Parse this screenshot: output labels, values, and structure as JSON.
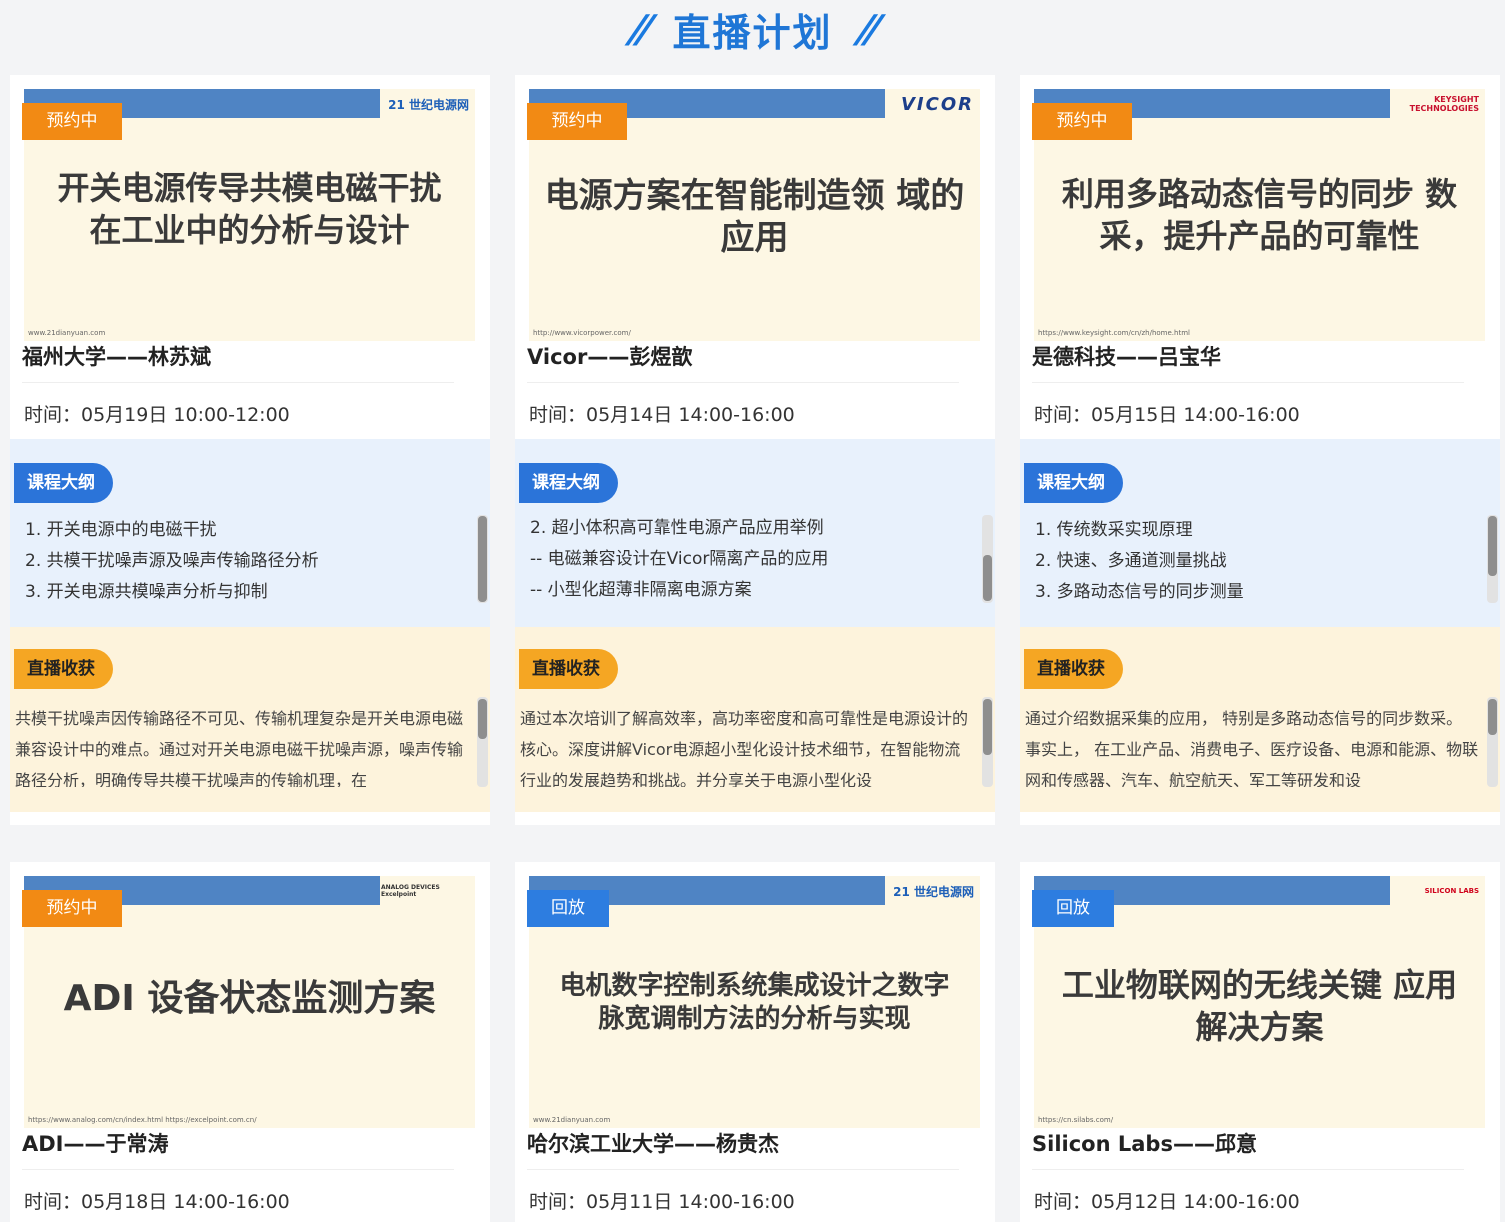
{
  "page": {
    "title": "直播计划"
  },
  "cards": [
    {
      "status": "预约中",
      "headline": "开关电源传导共模电磁干扰 在工业中的分析与设计",
      "logo": "21 世纪电源网",
      "url": "www.21dianyuan.com",
      "speaker": "福州大学——林苏斌",
      "time": "时间：05月19日 10:00-12:00",
      "outline_label": "课程大纲",
      "outline": [
        "1. 开关电源中的电磁干扰",
        "2. 共模干扰噪声源及噪声传输路径分析",
        "3. 开关电源共模噪声分析与抑制"
      ],
      "harvest_label": "直播收获",
      "harvest": "共模干扰噪声因传输路径不可见、传输机理复杂是开关电源电磁兼容设计中的难点。通过对开关电源电磁干扰噪声源，噪声传输路径分析，明确传导共模干扰噪声的传输机理，在"
    },
    {
      "status": "预约中",
      "headline": "电源方案在智能制造领 域的应用",
      "logo": "VICOR",
      "url": "http://www.vicorpower.com/",
      "speaker": "Vicor——彭煜歆",
      "time": "时间：05月14日 14:00-16:00",
      "outline_label": "课程大纲",
      "outline": [
        "2.  超小体积高可靠性电源产品应用举例",
        "-- 电磁兼容设计在Vicor隔离产品的应用",
        "-- 小型化超薄非隔离电源方案"
      ],
      "harvest_label": "直播收获",
      "harvest": "通过本次培训了解高效率，高功率密度和高可靠性是电源设计的核心。深度讲解Vicor电源超小型化设计技术细节，在智能物流行业的发展趋势和挑战。并分享关于电源小型化设"
    },
    {
      "status": "预约中",
      "headline": "利用多路动态信号的同步 数采，提升产品的可靠性",
      "logo": "KEYSIGHT TECHNOLOGIES",
      "url": "https://www.keysight.com/cn/zh/home.html",
      "speaker": "是德科技——吕宝华",
      "time": "时间：05月15日 14:00-16:00",
      "outline_label": "课程大纲",
      "outline": [
        "1. 传统数采实现原理",
        "2. 快速、多通道测量挑战",
        "3. 多路动态信号的同步测量"
      ],
      "harvest_label": "直播收获",
      "harvest": "通过介绍数据采集的应用， 特别是多路动态信号的同步数采。 事实上， 在工业产品、消费电子、医疗设备、电源和能源、物联网和传感器、汽车、航空航天、军工等研发和设"
    },
    {
      "status": "预约中",
      "headline": "ADI 设备状态监测方案",
      "logo": "ANALOG DEVICES  Excelpoint",
      "url": "https://www.analog.com/cn/index.html https://excelpoint.com.cn/",
      "speaker": "ADI——于常涛",
      "time": "时间：05月18日 14:00-16:00"
    },
    {
      "status": "回放",
      "headline": "电机数字控制系统集成设计之数字 脉宽调制方法的分析与实现",
      "logo": "21 世纪电源网",
      "url": "www.21dianyuan.com",
      "speaker": "哈尔滨工业大学——杨贵杰",
      "time": "时间：05月11日 14:00-16:00"
    },
    {
      "status": "回放",
      "headline": "工业物联网的无线关键 应用解决方案",
      "logo": "SILICON LABS",
      "url": "https://cn.silabs.com/",
      "speaker": "Silicon Labs——邱意",
      "time": "时间：05月12日 14:00-16:00"
    }
  ]
}
